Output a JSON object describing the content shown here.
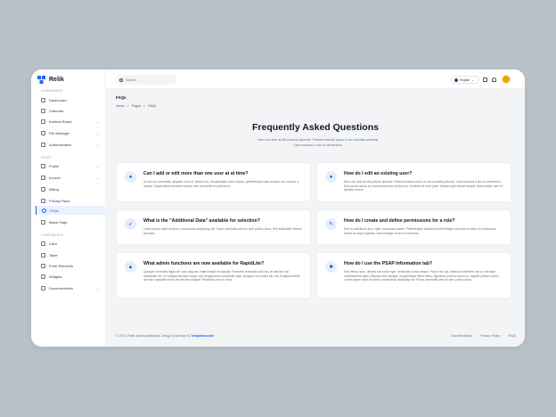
{
  "app": {
    "name": "Relik"
  },
  "sidebar": {
    "sections": [
      "Dashboards",
      "Pages",
      "Components"
    ],
    "items": [
      {
        "label": "Dashboard",
        "icon": "home-icon"
      },
      {
        "label": "Calendar",
        "icon": "calendar-icon"
      },
      {
        "label": "Kanban Board",
        "icon": "kanban-icon"
      },
      {
        "label": "File Manager",
        "icon": "folder-icon"
      },
      {
        "label": "Authentication",
        "icon": "lock-icon"
      },
      {
        "label": "Profile",
        "icon": "user-icon"
      },
      {
        "label": "Invoice",
        "icon": "invoice-icon"
      },
      {
        "label": "Billing",
        "icon": "billing-icon"
      },
      {
        "label": "Pricing Plans",
        "icon": "pricing-icon"
      },
      {
        "label": "FAQs",
        "icon": "faq-icon"
      },
      {
        "label": "Blank Page",
        "icon": "page-icon"
      },
      {
        "label": "Card",
        "icon": "card-icon"
      },
      {
        "label": "Table",
        "icon": "table-icon"
      },
      {
        "label": "Form Elements",
        "icon": "form-icon"
      },
      {
        "label": "Widgets",
        "icon": "widgets-icon"
      },
      {
        "label": "Documentation",
        "icon": "docs-icon"
      }
    ]
  },
  "topbar": {
    "search_placeholder": "Search",
    "language": "English"
  },
  "page": {
    "title": "FAQs",
    "breadcrumbs": [
      "Home",
      ">",
      "Pages",
      ">",
      "FAQs"
    ],
    "heading": "Frequently Asked Questions",
    "subtext": "Nam nec ante at elit pulvinar placerat. Praesent lacinia purus in dui convallis placerat. Cras euismod a nisi ut elementum."
  },
  "faqs": [
    {
      "q": "Can I add or edit more than one user at at time?",
      "a": "Ut sed orci venenatis, aliquam nunc ut, tempor leo. Suspendisse dolor massa, pellentesque vitae tempus non, tempor a massa. Suspendisse hendrerit massa velit, at blandit ex pulvinar in.",
      "icon": "users-icon"
    },
    {
      "q": "How do I edit an existing user?",
      "a": "Nam nec ante at elit pulvinar placerat. Praesent lacinia purus in dui convallis placerat. Cras euismod a nisi ut elementum. Duis auctor purus ac mi pharetra eros rhoncus id. Curabitur et enim justo. Nullam eget aliquet mauris. Nulla mattis, sem et facilisis viverra.",
      "icon": "edit-user-icon"
    },
    {
      "q": "What is the \"Additional Data\" available for selection?",
      "a": "Lorem ipsum dolor sit amet, consectetur adipiscing elit. Fusce venenatis sem eu sem porta cursus. Sed sollicitudin finibus tincidunt.",
      "icon": "rocket-icon"
    },
    {
      "q": "How do I create and define permissions for a role?",
      "a": "Sed ut sollicitudin arcu, eget consequat sapien. Pellentesque habitant morbi tristique senectus et netus et malesuada fames ac turpis egestas. Nam tristique et orci eu vehicula.",
      "icon": "key-icon"
    },
    {
      "q": "What admin functions are now available for RapidLite?",
      "a": "Quisque venenatis ligula vel nunc aliquam, vitae blandit mi suscipit. Praesent venenatis odio nisl, at ultricies nisl sollicitudin vel. Ut volutpat tincidunt turpis, sed fringilla dolor sollicitudin quis. Quisque non luctus elit, nec fringilla porttitor. Aenean vulputate lorem vel lobortis volutpat. Phasellus non ex tortor.",
      "icon": "user-admin-icon"
    },
    {
      "q": "How do I use the PSAP Information tab?",
      "a": "Sed metus nunc, ultrices nec tortor eget, venenatis cursus neque. Fusce nec dui, bibendum eleifend nisi ut, interdum condimentum diam. Aliquam erat volutpat. Suspendisse libero tellus, dignissim pulvinar ipsum in, sagittis pretium luctus. Lorem ipsum dolor sit amet, consectetur adipiscing elit. Fusce venenatis sem eu sem porta cursus.",
      "icon": "info-icon"
    }
  ],
  "footer": {
    "copyright": "© 2021. Relik admin dashboard. Design & develop by",
    "author": "Templatecookie",
    "links": [
      "Documentation",
      "Privacy Policy",
      "FAQs"
    ]
  }
}
